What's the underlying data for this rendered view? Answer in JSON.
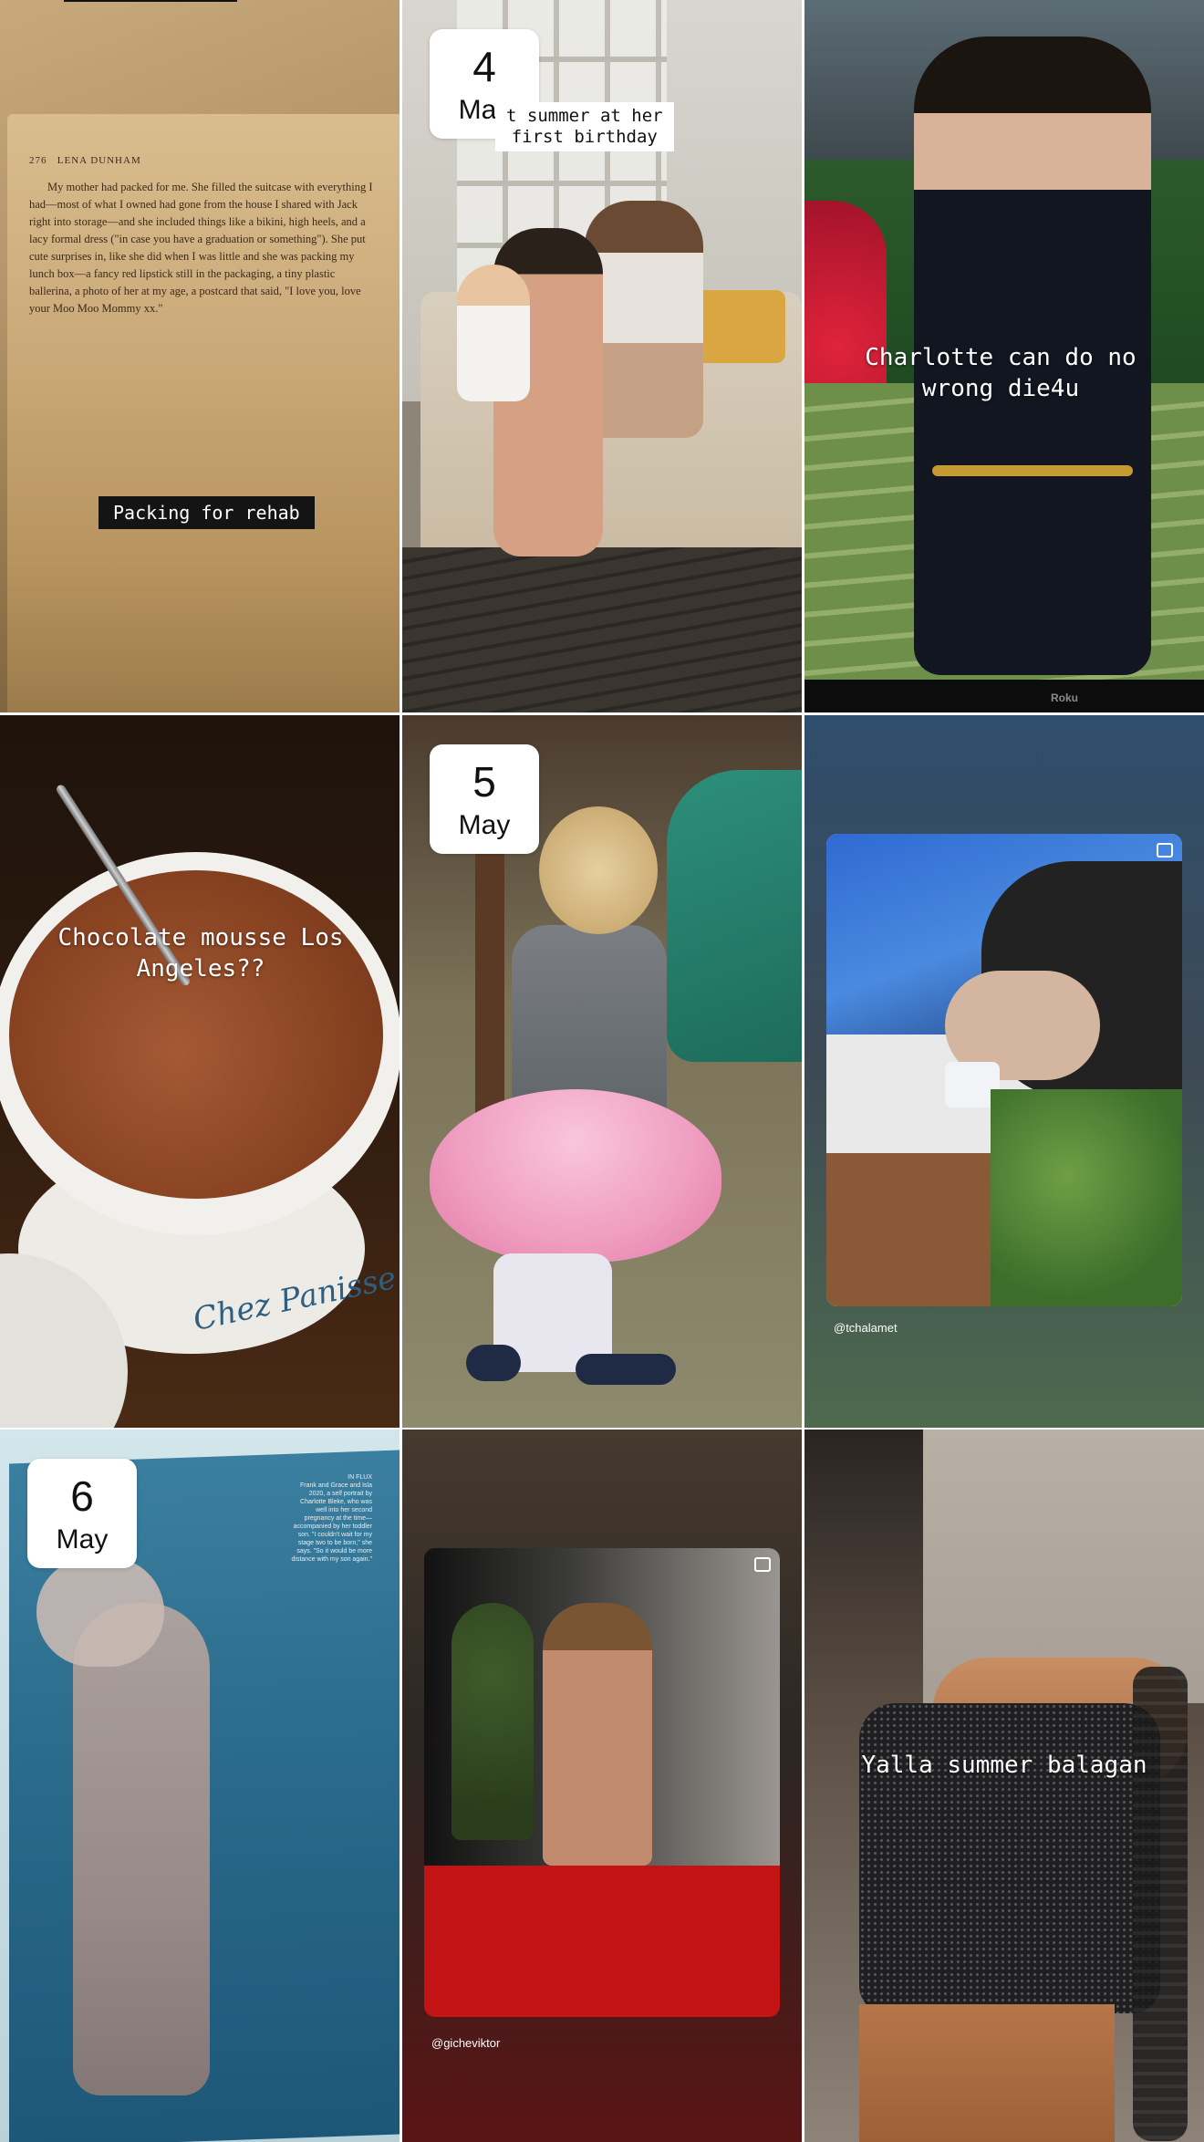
{
  "dates": {
    "d1": {
      "day": "4",
      "month": "May"
    },
    "d2": {
      "day": "5",
      "month": "May"
    },
    "d3": {
      "day": "6",
      "month": "May"
    }
  },
  "tiles": {
    "t1": {
      "caption": "Packing for rehab",
      "book_header": "276   LENA DUNHAM",
      "book_body": "My mother had packed for me. She filled the suitcase with everything I had—most of what I owned had gone from the house I shared with Jack right into storage—and she included things like a bikini, high heels, and a lacy formal dress (\"in case you have a graduation or something\"). She put cute surprises in, like she did when I was little and she was packing my lunch box—a fancy red lipstick still in the packaging, a tiny plastic ballerina, a photo of her at my age, a postcard that said, \"I love you, love your Moo Moo Mommy xx.\""
    },
    "t2": {
      "caption_line1": "t summer at her",
      "caption_line2": "first birthday"
    },
    "t3": {
      "caption": "Charlotte can do no wrong die4u",
      "tv_brand": "Roku"
    },
    "t4": {
      "caption": "Chocolate mousse Los Angeles??",
      "bowl_text": "Chez Panisse"
    },
    "t5": {},
    "t6": {
      "handle": "@tchalamet"
    },
    "t7": {
      "magazine_text": "IN FLUX\nFrank and Grace and Isla 2020, a self portrait by Charlotte Bleke, who was well into her second pregnancy at the time—accompanied by her toddler son. \"I couldn't wait for my stage two to be born,\" she says. \"So it would be more distance with my son again.\""
    },
    "t8": {
      "handle": "@gicheviktor"
    },
    "t9": {
      "caption": "Yalla summer balagan"
    }
  },
  "colors": {
    "badge_bg": "#ffffff",
    "caption_dark_bg": "#141414",
    "caption_text": "#ffffff"
  }
}
